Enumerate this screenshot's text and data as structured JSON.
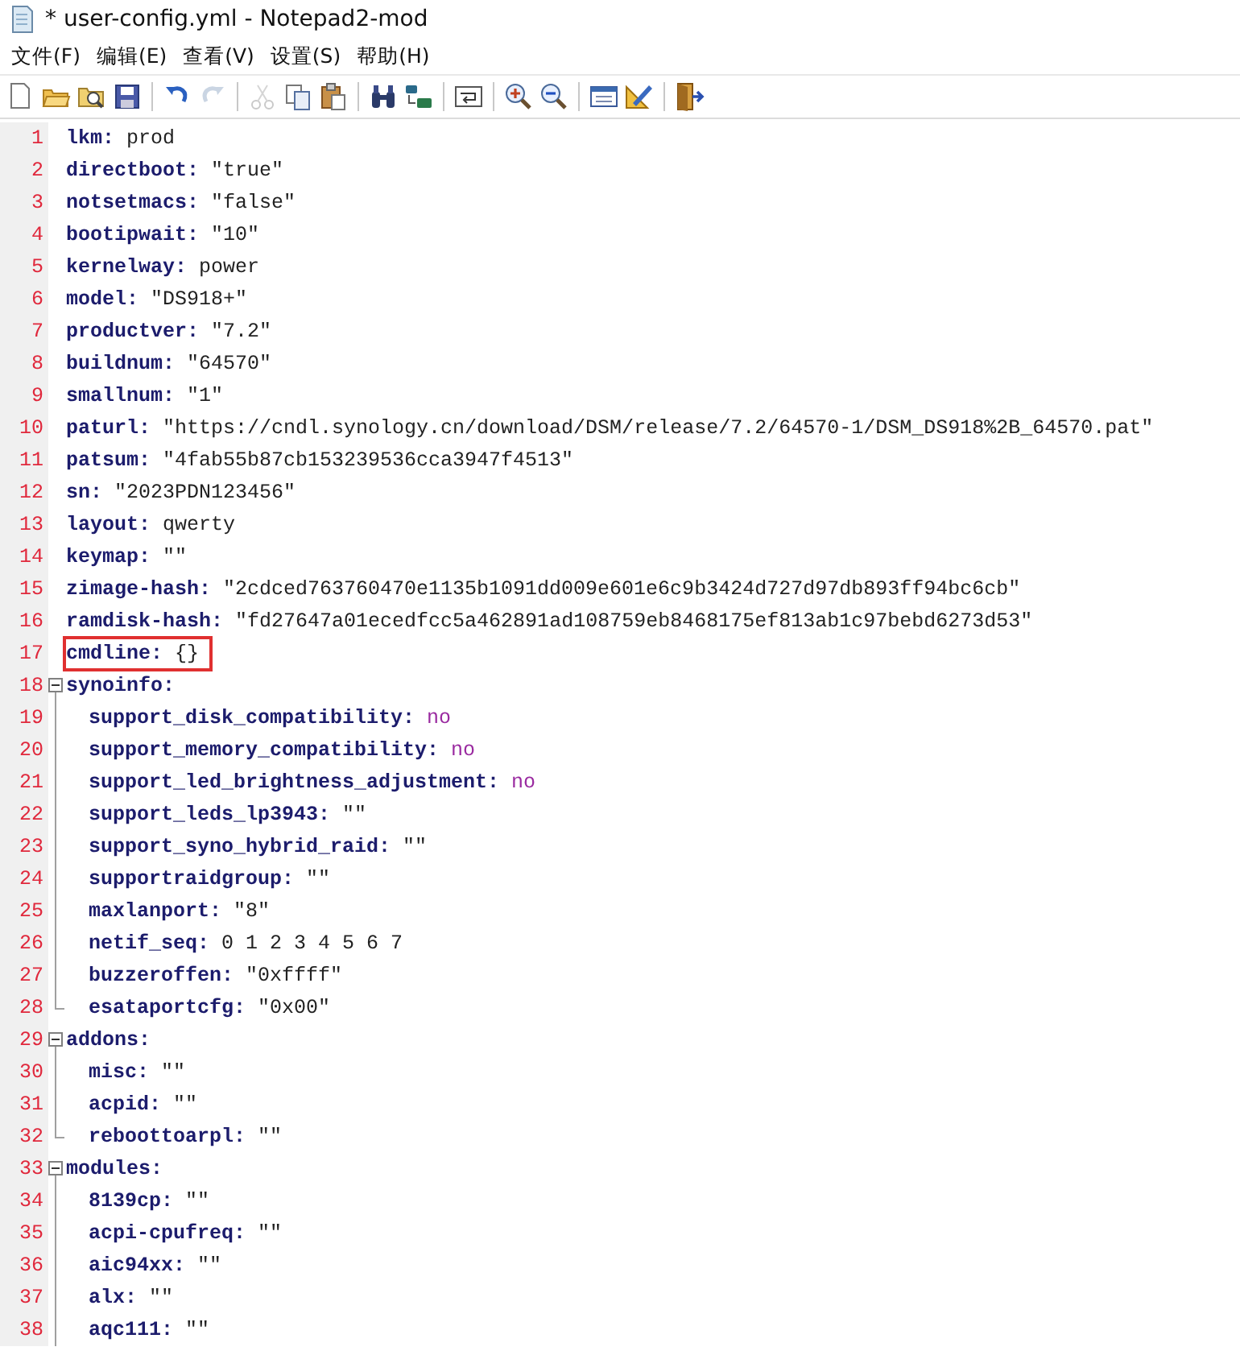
{
  "window": {
    "title": "* user-config.yml - Notepad2-mod"
  },
  "menu": [
    "文件(F)",
    "编辑(E)",
    "查看(V)",
    "设置(S)",
    "帮助(H)"
  ],
  "toolbar": [
    [
      {
        "disabled": false
      },
      {
        "disabled": false
      },
      {
        "disabled": false
      },
      {
        "disabled": false
      }
    ],
    [
      {
        "disabled": false
      },
      {
        "disabled": true
      }
    ],
    [
      {
        "disabled": true
      },
      {
        "disabled": false
      },
      {
        "disabled": false
      }
    ],
    [
      {
        "disabled": false
      },
      {
        "disabled": false
      }
    ],
    [
      {
        "disabled": false
      }
    ],
    [
      {
        "disabled": false
      },
      {
        "disabled": false
      }
    ],
    [
      {
        "disabled": false
      },
      {
        "disabled": false
      }
    ],
    [
      {
        "disabled": false
      }
    ]
  ],
  "editor": {
    "lines": [
      {
        "number": "1",
        "key": "lkm:",
        "value": "prod",
        "kind": "scalar"
      },
      {
        "number": "2",
        "key": "directboot:",
        "value": "\"true\"",
        "kind": "scalar"
      },
      {
        "number": "3",
        "key": "notsetmacs:",
        "value": "\"false\"",
        "kind": "scalar"
      },
      {
        "number": "4",
        "key": "bootipwait:",
        "value": "\"10\"",
        "kind": "scalar"
      },
      {
        "number": "5",
        "key": "kernelway:",
        "value": "power",
        "kind": "scalar"
      },
      {
        "number": "6",
        "key": "model:",
        "value": "\"DS918+\"",
        "kind": "scalar"
      },
      {
        "number": "7",
        "key": "productver:",
        "value": "\"7.2\"",
        "kind": "scalar"
      },
      {
        "number": "8",
        "key": "buildnum:",
        "value": "\"64570\"",
        "kind": "scalar"
      },
      {
        "number": "9",
        "key": "smallnum:",
        "value": "\"1\"",
        "kind": "scalar"
      },
      {
        "number": "10",
        "key": "paturl:",
        "value": "\"https://cndl.synology.cn/download/DSM/release/7.2/64570-1/DSM_DS918%2B_64570.pat\"",
        "kind": "scalar"
      },
      {
        "number": "11",
        "key": "patsum:",
        "value": "\"4fab55b87cb153239536cca3947f4513\"",
        "kind": "scalar"
      },
      {
        "number": "12",
        "key": "sn:",
        "value": "\"2023PDN123456\"",
        "kind": "scalar"
      },
      {
        "number": "13",
        "key": "layout:",
        "value": "qwerty",
        "kind": "scalar"
      },
      {
        "number": "14",
        "key": "keymap:",
        "value": "\"\"",
        "kind": "scalar"
      },
      {
        "number": "15",
        "key": "zimage-hash:",
        "value": "\"2cdced763760470e1135b1091dd009e601e6c9b3424d727d97db893ff94bc6cb\"",
        "kind": "scalar"
      },
      {
        "number": "16",
        "key": "ramdisk-hash:",
        "value": "\"fd27647a01ecedfcc5a462891ad108759eb8468175ef813ab1c97bebd6273d53\"",
        "kind": "scalar"
      },
      {
        "number": "17",
        "key": "cmdline:",
        "value": "{}",
        "kind": "scalar",
        "highlighted": true
      },
      {
        "number": "18",
        "key": "synoinfo:",
        "expanded": true,
        "children": [
          {
            "number": "19",
            "key": "support_disk_compatibility:",
            "value": "no",
            "kind": "bool"
          },
          {
            "number": "20",
            "key": "support_memory_compatibility:",
            "value": "no",
            "kind": "bool"
          },
          {
            "number": "21",
            "key": "support_led_brightness_adjustment:",
            "value": "no",
            "kind": "bool"
          },
          {
            "number": "22",
            "key": "support_leds_lp3943:",
            "value": "\"\"",
            "kind": "scalar"
          },
          {
            "number": "23",
            "key": "support_syno_hybrid_raid:",
            "value": "\"\"",
            "kind": "scalar"
          },
          {
            "number": "24",
            "key": "supportraidgroup:",
            "value": "\"\"",
            "kind": "scalar"
          },
          {
            "number": "25",
            "key": "maxlanport:",
            "value": "\"8\"",
            "kind": "scalar"
          },
          {
            "number": "26",
            "key": "netif_seq:",
            "value": "0 1 2 3 4 5 6 7",
            "kind": "scalar"
          },
          {
            "number": "27",
            "key": "buzzeroffen:",
            "value": "\"0xffff\"",
            "kind": "scalar"
          },
          {
            "number": "28",
            "key": "esataportcfg:",
            "value": "\"0x00\"",
            "kind": "scalar"
          }
        ]
      },
      {
        "number": "29",
        "key": "addons:",
        "expanded": true,
        "children": [
          {
            "number": "30",
            "key": "misc:",
            "value": "\"\"",
            "kind": "scalar"
          },
          {
            "number": "31",
            "key": "acpid:",
            "value": "\"\"",
            "kind": "scalar"
          },
          {
            "number": "32",
            "key": "reboottoarpl:",
            "value": "\"\"",
            "kind": "scalar"
          }
        ]
      },
      {
        "number": "33",
        "key": "modules:",
        "expanded": true,
        "continues": true,
        "children": [
          {
            "number": "34",
            "key": "8139cp:",
            "value": "\"\"",
            "kind": "scalar"
          },
          {
            "number": "35",
            "key": "acpi-cpufreq:",
            "value": "\"\"",
            "kind": "scalar"
          },
          {
            "number": "36",
            "key": "aic94xx:",
            "value": "\"\"",
            "kind": "scalar"
          },
          {
            "number": "37",
            "key": "alx:",
            "value": "\"\"",
            "kind": "scalar"
          },
          {
            "number": "38",
            "key": "aqc111:",
            "value": "\"\"",
            "kind": "scalar"
          }
        ]
      }
    ]
  }
}
